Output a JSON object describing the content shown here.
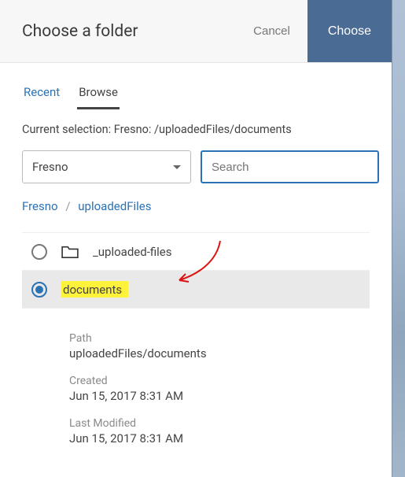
{
  "header": {
    "title": "Choose a folder",
    "cancel": "Cancel",
    "choose": "Choose"
  },
  "tabs": {
    "recent": "Recent",
    "browse": "Browse"
  },
  "selection_prefix": "Current selection: ",
  "selection_value": "Fresno: /uploadedFiles/documents",
  "site_select": {
    "value": "Fresno"
  },
  "search": {
    "placeholder": "Search"
  },
  "breadcrumb": {
    "items": [
      "Fresno",
      "uploadedFiles"
    ],
    "sep": "/"
  },
  "folders": [
    {
      "name": "_uploaded-files",
      "selected": false
    },
    {
      "name": "documents",
      "selected": true
    }
  ],
  "details": {
    "path_label": "Path",
    "path_value": "uploadedFiles/documents",
    "created_label": "Created",
    "created_value": "Jun 15, 2017 8:31 AM",
    "modified_label": "Last Modified",
    "modified_value": "Jun 15, 2017 8:31 AM"
  }
}
